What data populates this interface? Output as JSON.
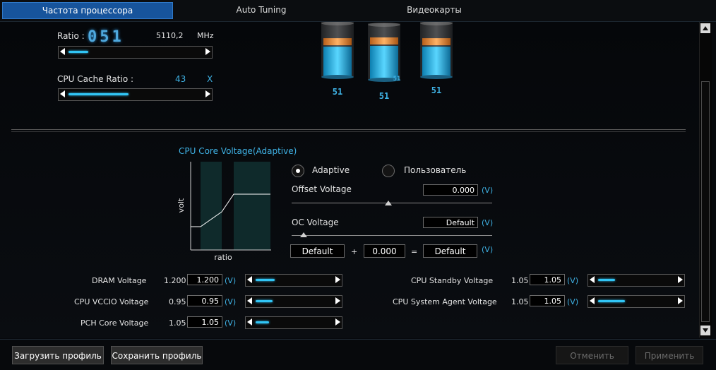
{
  "tabs": [
    "Частота процессора",
    "Auto Tuning",
    "Видеокарты"
  ],
  "ratio": {
    "label": "Ratio :",
    "display": "051",
    "freq": "5110,2",
    "unit": "MHz",
    "slider_fraction": 0.15
  },
  "cache_ratio": {
    "label": "CPU Cache Ratio :",
    "value": "43",
    "unit": "X",
    "slider_fraction": 0.45
  },
  "cores": [
    {
      "top": "",
      "label": "51",
      "fill": 0.55
    },
    {
      "top": "51",
      "label": "51",
      "fill": 0.6
    },
    {
      "top": "",
      "label": "51",
      "fill": 0.55
    }
  ],
  "voltage": {
    "title": "CPU Core Voltage(Adaptive)",
    "graph_ylabel": "volt",
    "graph_xlabel": "ratio",
    "mode_adaptive": "Adaptive",
    "mode_user": "Пользователь",
    "offset_label": "Offset Voltage",
    "offset_value": "0.000",
    "offset_unit": "(V)",
    "oc_label": "OC Voltage",
    "oc_value": "Default",
    "oc_unit": "(V)",
    "sum_a": "Default",
    "plus": "+",
    "sum_b": "0.000",
    "equals": "=",
    "sum_result": "Default",
    "sum_unit": "(V)"
  },
  "left_voltages": [
    {
      "name": "DRAM Voltage",
      "value": "1.200",
      "input": "1.200",
      "unit": "(V)",
      "slider_fraction": 0.25
    },
    {
      "name": "CPU VCCIO Voltage",
      "value": "0.95",
      "input": "0.95",
      "unit": "(V)",
      "slider_fraction": 0.22
    },
    {
      "name": "PCH Core Voltage",
      "value": "1.05",
      "input": "1.05",
      "unit": "(V)",
      "slider_fraction": 0.18
    }
  ],
  "right_voltages": [
    {
      "name": "CPU Standby Voltage",
      "value": "1.05",
      "input": "1.05",
      "unit": "(V)",
      "slider_fraction": 0.22
    },
    {
      "name": "CPU System Agent Voltage",
      "value": "1.05",
      "input": "1.05",
      "unit": "(V)",
      "slider_fraction": 0.35
    }
  ],
  "buttons": {
    "load": "Загрузить профиль",
    "save": "Сохранить профиль",
    "cancel": "Отменить",
    "apply": "Применить"
  }
}
